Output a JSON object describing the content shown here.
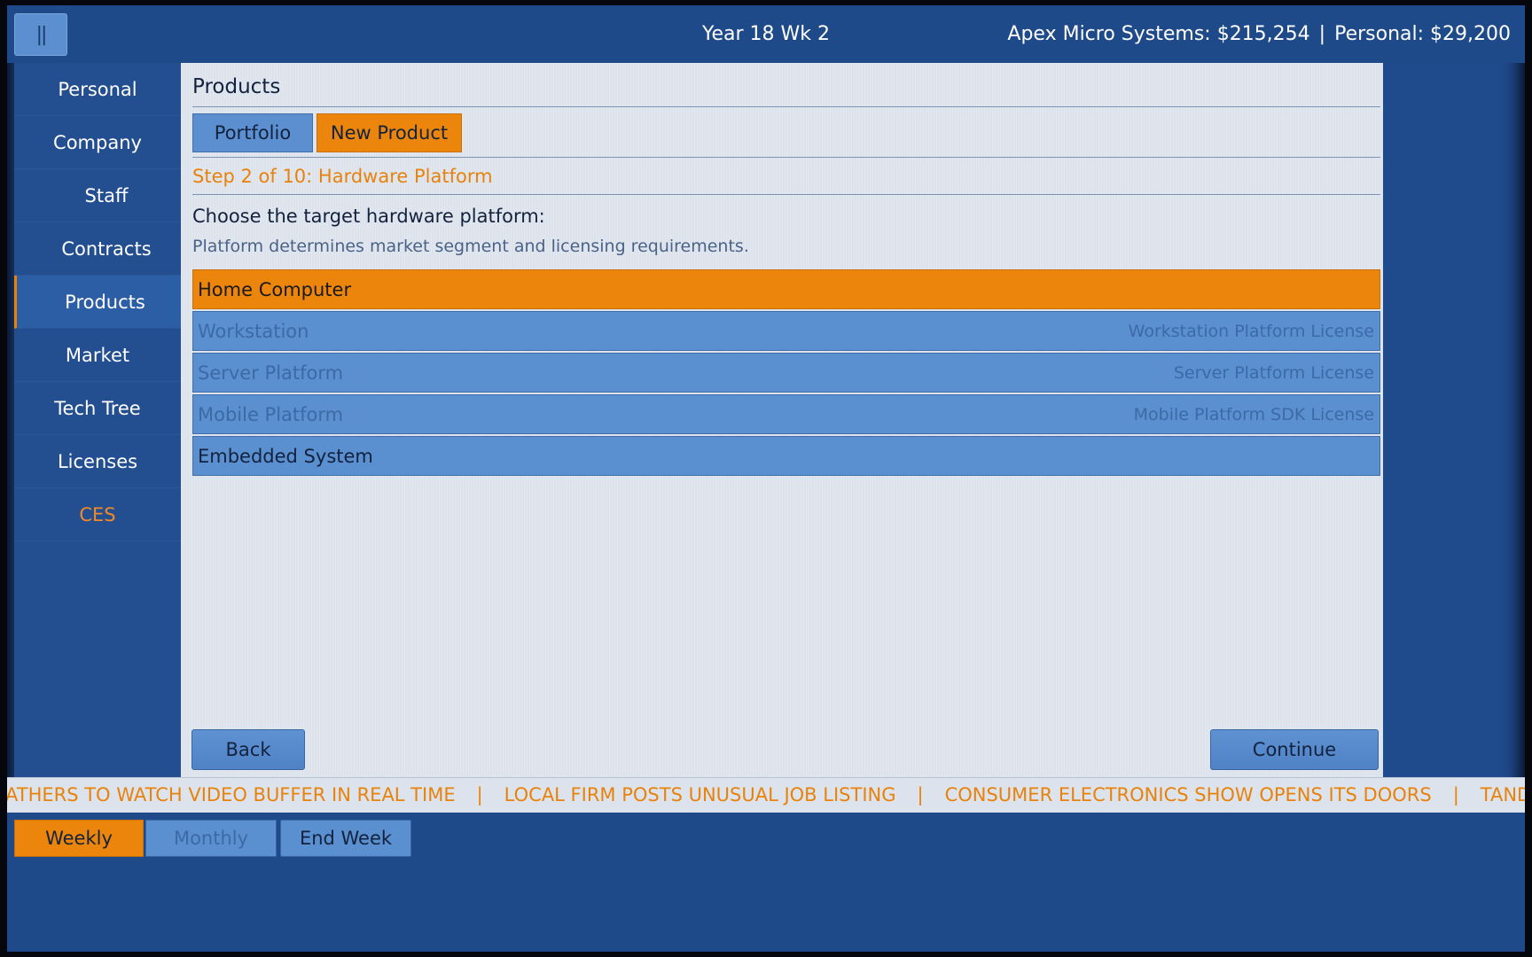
{
  "header": {
    "pause_label": "||",
    "date": "Year 18  Wk 2",
    "company_funds": "Apex Micro Systems: $215,254",
    "separator": "|",
    "personal_funds": "Personal: $29,200"
  },
  "sidebar": {
    "items": [
      {
        "label": "Personal"
      },
      {
        "label": "Company"
      },
      {
        "label": "Staff"
      },
      {
        "label": "Contracts"
      },
      {
        "label": "Products",
        "active": true
      },
      {
        "label": "Market"
      },
      {
        "label": "Tech Tree"
      },
      {
        "label": "Licenses"
      },
      {
        "label": "CES",
        "accent_color": "#f0892a"
      }
    ]
  },
  "main": {
    "title": "Products",
    "tabs": [
      {
        "label": "Portfolio"
      },
      {
        "label": "New Product",
        "selected": true
      }
    ],
    "step": "Step 2 of 10: Hardware Platform",
    "question": "Choose the target hardware platform:",
    "hint": "Platform determines market segment and licensing requirements.",
    "options": [
      {
        "label": "Home Computer",
        "state": "selected",
        "requirement": ""
      },
      {
        "label": "Workstation",
        "state": "locked",
        "requirement": "Workstation Platform License"
      },
      {
        "label": "Server Platform",
        "state": "locked",
        "requirement": "Server Platform License"
      },
      {
        "label": "Mobile Platform",
        "state": "locked",
        "requirement": "Mobile Platform SDK License"
      },
      {
        "label": "Embedded System",
        "state": "available",
        "requirement": ""
      }
    ],
    "back_label": "Back",
    "continue_label": "Continue"
  },
  "ticker": {
    "headlines": [
      "ATHERS TO WATCH VIDEO BUFFER IN REAL TIME",
      "LOCAL FIRM POSTS UNUSUAL JOB LISTING",
      "CONSUMER ELECTRONICS SHOW OPENS ITS DOORS",
      "TANDY"
    ],
    "separator": "|"
  },
  "footer": {
    "weekly_label": "Weekly",
    "monthly_label": "Monthly",
    "end_week_label": "End Week"
  },
  "colors": {
    "accent": "#ec850b",
    "panel_blue": "#1e4a8a",
    "button_blue": "#5a8fd0"
  }
}
